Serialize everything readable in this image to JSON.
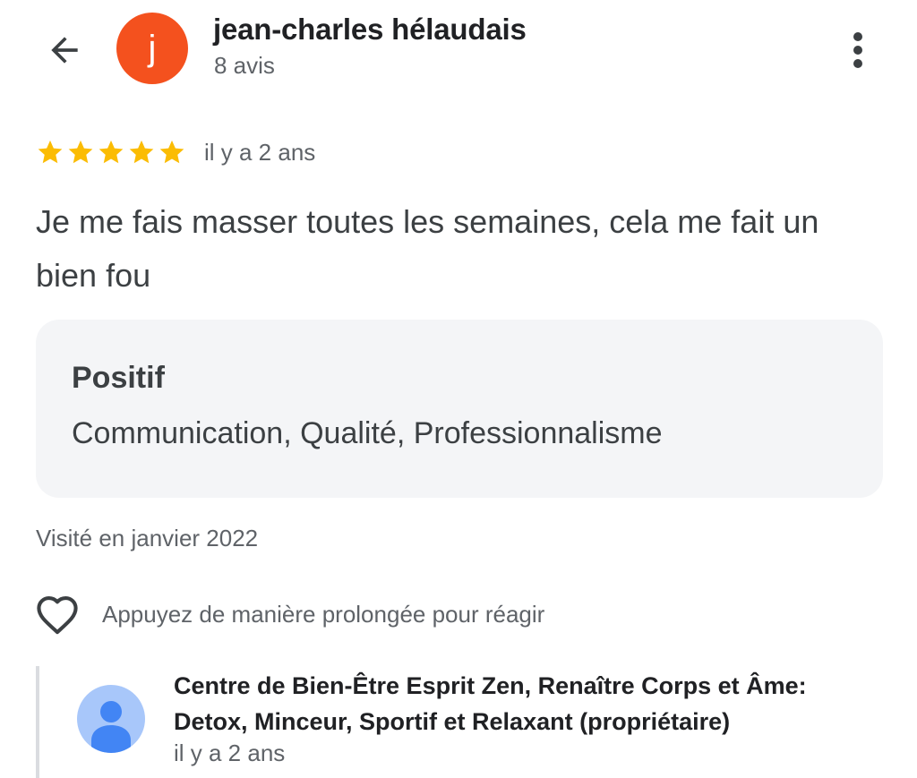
{
  "header": {
    "avatar_letter": "j",
    "avatar_color": "#f4511e",
    "reviewer_name": "jean-charles hélaudais",
    "review_count": "8 avis",
    "back_icon": "arrow-back-icon",
    "more_icon": "more-vert-icon"
  },
  "review": {
    "rating": 5,
    "max_rating": 5,
    "star_color": "#fbbc04",
    "time": "il y a 2 ans",
    "text": "Je me fais masser toutes les semaines, cela me fait un bien fou"
  },
  "positive": {
    "title": "Positif",
    "values": "Communication, Qualité, Professionnalisme"
  },
  "visited": "Visité en janvier 2022",
  "reaction": {
    "icon": "heart-outline-icon",
    "hint": "Appuyez de manière prolongée pour réagir"
  },
  "owner_reply": {
    "name": "Centre de Bien-Être Esprit Zen, Renaître Corps et Âme: Detox, Minceur, Sportif et Relaxant (propriétaire)",
    "time": "il y a 2 ans",
    "avatar_icon": "person-icon",
    "avatar_color": "#a8c7fa"
  }
}
